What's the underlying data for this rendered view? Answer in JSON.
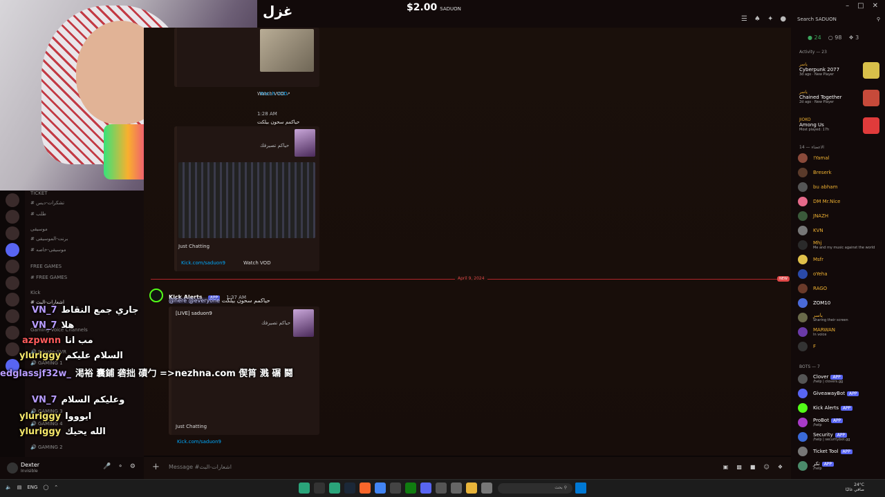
{
  "window": {
    "channel_title": "غزل",
    "donation_amount": "$2.00",
    "donation_user": "SADUON",
    "search_label": "Search",
    "search_user": "SADUON"
  },
  "channels": {
    "items": [
      "TICKET",
      "تشكرات-ديس",
      "طلب",
      "موسيقى",
      "برنت-الموسيقى",
      "موسيقى-خاصه",
      "FREE GAMES",
      "FREE GAMES",
      "Kick",
      "اشعارات-البث",
      "Gaming Voice Channels",
      "Private-SVR",
      "GAMING 1",
      "GAMING 4",
      "GAMING 2",
      "GAMING 3"
    ]
  },
  "overlay_chat": [
    {
      "user": "VN_7",
      "text": "جاري جمع النقاط"
    },
    {
      "user": "VN_7",
      "text": "هلا"
    },
    {
      "user": "azpwnn",
      "text": "مب انا"
    },
    {
      "user": "yluriggy",
      "text": "السلام عليكم"
    },
    {
      "user": "edglassjf32w_",
      "text": "渇裕 囊鋪 砻拙 磧勹 =>nezhna.com 偰筲 溅 碿 鬪"
    },
    {
      "user": "VN_7",
      "text": "وعليكم السلام"
    },
    {
      "user": "yluriggy",
      "text": "ايوووا"
    },
    {
      "user": "yluriggy",
      "text": "الله يحيك"
    }
  ],
  "messages": {
    "embed1_watch": "Watch VOD",
    "embed2_time": "1:28 AM",
    "embed2_text": "حياكمم سحون بيلكت",
    "embed2_sub": "حياكم تصيرفك",
    "embed2_game": "Just Chatting",
    "embed2_link": "Kick.com/saduon9",
    "embed2_watch": "Watch VOD",
    "date_divider": "April 9, 2024",
    "new_badge": "NEW",
    "msg3_author": "Kick Alerts",
    "msg3_app": "APP",
    "msg3_time": "1:37 AM",
    "msg3_mentions": "@here @everyone",
    "msg3_text": "حياكمم سحون بيلكت",
    "msg3_embed_title": "[LIVE] saduon9",
    "msg3_embed_sub": "حياكم تصيرفك",
    "msg3_game": "Just Chatting",
    "msg3_link": "Kick.com/saduon9"
  },
  "composer": {
    "placeholder": "Message #اشعارات-البث"
  },
  "user": {
    "name": "Dexter",
    "status": "Invisible"
  },
  "right": {
    "stat_online": "24",
    "stat_offline": "98",
    "stat_boost": "3",
    "activity_label": "Activity — 23",
    "activities": [
      {
        "name": "ياسر",
        "game": "Cyberpunk 2077",
        "sub": "3d ago  ·  New Player",
        "color": "#d8c04a"
      },
      {
        "name": "ياسر",
        "game": "Chained Together",
        "sub": "2d ago  ·  New Player",
        "color": "#c74a3a"
      },
      {
        "name": "JIOKO",
        "game": "Among Us",
        "sub": "Most played: 17h",
        "color": "#e03b3b"
      }
    ],
    "members_label": "الاعضاء — 14",
    "members": [
      {
        "name": "!Yamal",
        "sub": "",
        "color": "#f0b232",
        "av": "#8a4a3a"
      },
      {
        "name": "Breserk",
        "sub": "",
        "color": "#f0b232",
        "av": "#5a3a2a"
      },
      {
        "name": "bu abham",
        "sub": "",
        "color": "#f0b232",
        "av": "#555"
      },
      {
        "name": "DM Mr.Nice",
        "sub": "",
        "color": "#f0b232",
        "av": "#e66a8a"
      },
      {
        "name": "JNAZH",
        "sub": "",
        "color": "#f0b232",
        "av": "#3a5a3a"
      },
      {
        "name": "KVN",
        "sub": "",
        "color": "#f0b232",
        "av": "#777"
      },
      {
        "name": "Mhj",
        "sub": "Me and my music against the world",
        "color": "#f0b232",
        "av": "#2a2a2a"
      },
      {
        "name": "Msfr",
        "sub": "",
        "color": "#f0b232",
        "av": "#e0c04a"
      },
      {
        "name": "oYeha",
        "sub": "",
        "color": "#f0b232",
        "av": "#2a4aa8"
      },
      {
        "name": "RAGO",
        "sub": "",
        "color": "#f0b232",
        "av": "#6a3a2a"
      },
      {
        "name": "ZOM10",
        "sub": "",
        "color": "#fff",
        "av": "#4a6ad8"
      },
      {
        "name": "ياسر",
        "sub": "Sharing their screen",
        "color": "#f0b232",
        "av": "#6a6a4a"
      },
      {
        "name": "MARWAN",
        "sub": "In voice",
        "color": "#f0b232",
        "av": "#6a3aa8"
      },
      {
        "name": "F",
        "sub": "",
        "color": "#f0b232",
        "av": "#333"
      }
    ],
    "bots_label": "BOTS — 7",
    "bots": [
      {
        "name": "Clover",
        "sub": "/help | clovers.gg",
        "av": "#555"
      },
      {
        "name": "GiveawayBot",
        "sub": "",
        "av": "#5865f2"
      },
      {
        "name": "Kick Alerts",
        "sub": "",
        "av": "#53fc18"
      },
      {
        "name": "ProBot",
        "sub": "/help",
        "av": "#a83ac8"
      },
      {
        "name": "Security",
        "sub": "/help | securitybot.gg",
        "av": "#3a6ad8"
      },
      {
        "name": "Ticket Tool",
        "sub": "",
        "av": "#777"
      },
      {
        "name": "تكر",
        "sub": "/help",
        "av": "#4a8a6a"
      }
    ]
  },
  "taskbar": {
    "lang": "ENG",
    "search": "بحث",
    "weather": "24°C",
    "weather_sub": "صافي غالبًا"
  },
  "colors": {
    "accent_green": "#53fc18",
    "divider_red": "#b2262a",
    "app_blue": "#5865f2"
  }
}
